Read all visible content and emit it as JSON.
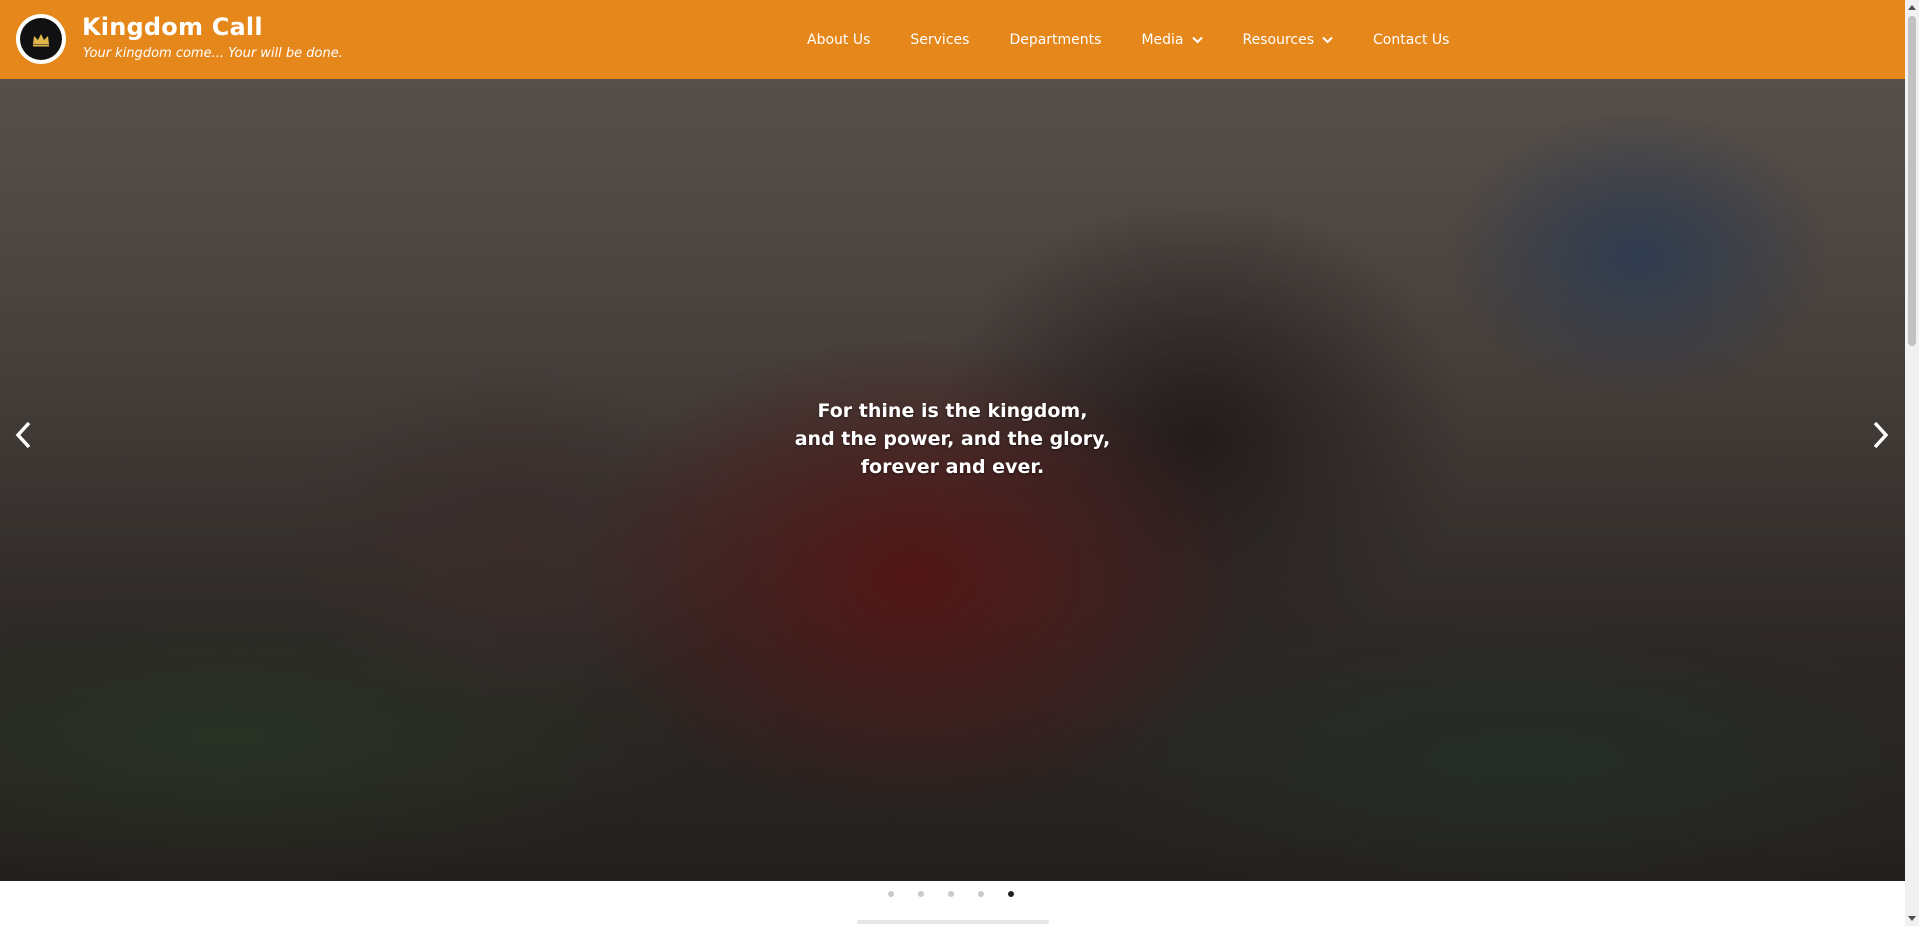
{
  "header": {
    "brand_title": "Kingdom Call",
    "brand_tagline": "Your kingdom come... Your will be done.",
    "logo_icon": "crown-icon",
    "background_color": "#e5871b"
  },
  "nav": {
    "items": [
      {
        "label": "About Us",
        "has_dropdown": false
      },
      {
        "label": "Services",
        "has_dropdown": false
      },
      {
        "label": "Departments",
        "has_dropdown": false
      },
      {
        "label": "Media",
        "has_dropdown": true
      },
      {
        "label": "Resources",
        "has_dropdown": true
      },
      {
        "label": "Contact Us",
        "has_dropdown": false
      }
    ]
  },
  "hero": {
    "caption_lines": [
      "For thine is the kingdom,",
      "and the power, and the glory,",
      "forever and ever."
    ],
    "prev_icon": "chevron-left-icon",
    "next_icon": "chevron-right-icon"
  },
  "carousel": {
    "slide_count": 5,
    "active_index": 4
  }
}
